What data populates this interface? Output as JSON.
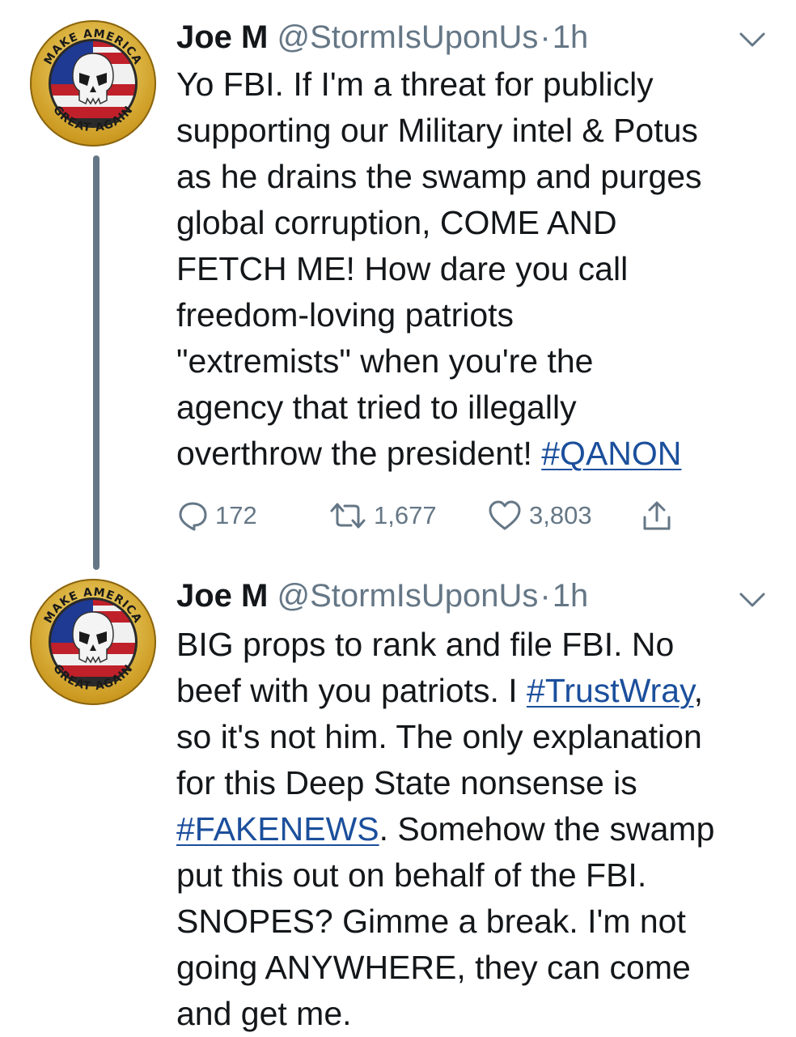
{
  "tweets": [
    {
      "name": "Joe M",
      "handle": "@StormIsUponUs",
      "separator": "·",
      "time": "1h",
      "text_lines": [
        "Yo FBI. If I'm a threat for publicly",
        "supporting our Military intel & Potus",
        "as he drains the swamp and purges",
        "global corruption, COME AND",
        "FETCH ME! How dare you call",
        "freedom-loving patriots",
        "\"extremists\" when you're the",
        "agency that tried to illegally",
        "overthrow the president! "
      ],
      "hashtag": "#QANON",
      "stats": {
        "replies": "172",
        "retweets": "1,677",
        "likes": "3,803"
      }
    },
    {
      "name": "Joe M",
      "handle": "@StormIsUponUs",
      "separator": "·",
      "time": "1h",
      "line1": "BIG props to rank and file FBI. No",
      "line2_pre": "beef with you patriots. I ",
      "line2_tag": "#TrustWray",
      "line2_post": ",",
      "line3": "so it's not him. The only explanation",
      "line4": "for this Deep State nonsense is",
      "line5_tag": "#FAKENEWS",
      "line5_post": ". Somehow the swamp",
      "line6": "put this out on behalf of the FBI.",
      "line7": "SNOPES? Gimme a break. I'm not",
      "line8": "going ANYWHERE, they can come",
      "line9": "and get me."
    }
  ],
  "avatar": {
    "ring_text_top": "MAKE AMERICA",
    "ring_text_bottom": "GREAT AGAIN"
  },
  "colors": {
    "text": "#14171a",
    "secondary": "#657786",
    "link": "#1b4f9c",
    "gold": "#d4a017",
    "thread_line": "#657786"
  },
  "icons": [
    "avatar-skull-logo",
    "chevron-down-icon",
    "reply-icon",
    "retweet-icon",
    "like-icon",
    "share-icon"
  ]
}
